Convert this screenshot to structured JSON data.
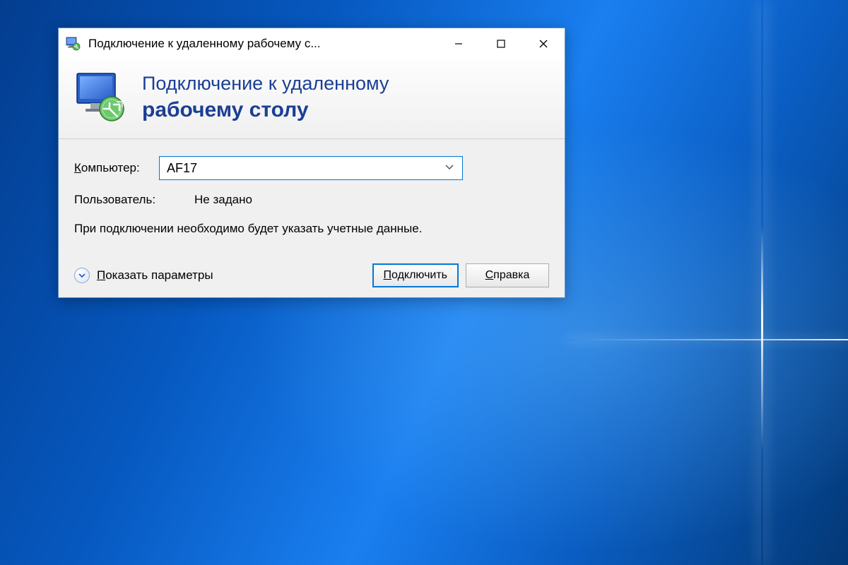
{
  "window": {
    "title": "Подключение к удаленному рабочему с..."
  },
  "header": {
    "line1": "Подключение к удаленному",
    "line2": "рабочему столу"
  },
  "form": {
    "computer_label": "Компьютер:",
    "computer_value": "AF17",
    "user_label": "Пользователь:",
    "user_value": "Не задано",
    "info_text": "При подключении необходимо будет указать учетные данные."
  },
  "footer": {
    "show_options": "Показать параметры",
    "connect": "Подключить",
    "help": "Справка"
  }
}
